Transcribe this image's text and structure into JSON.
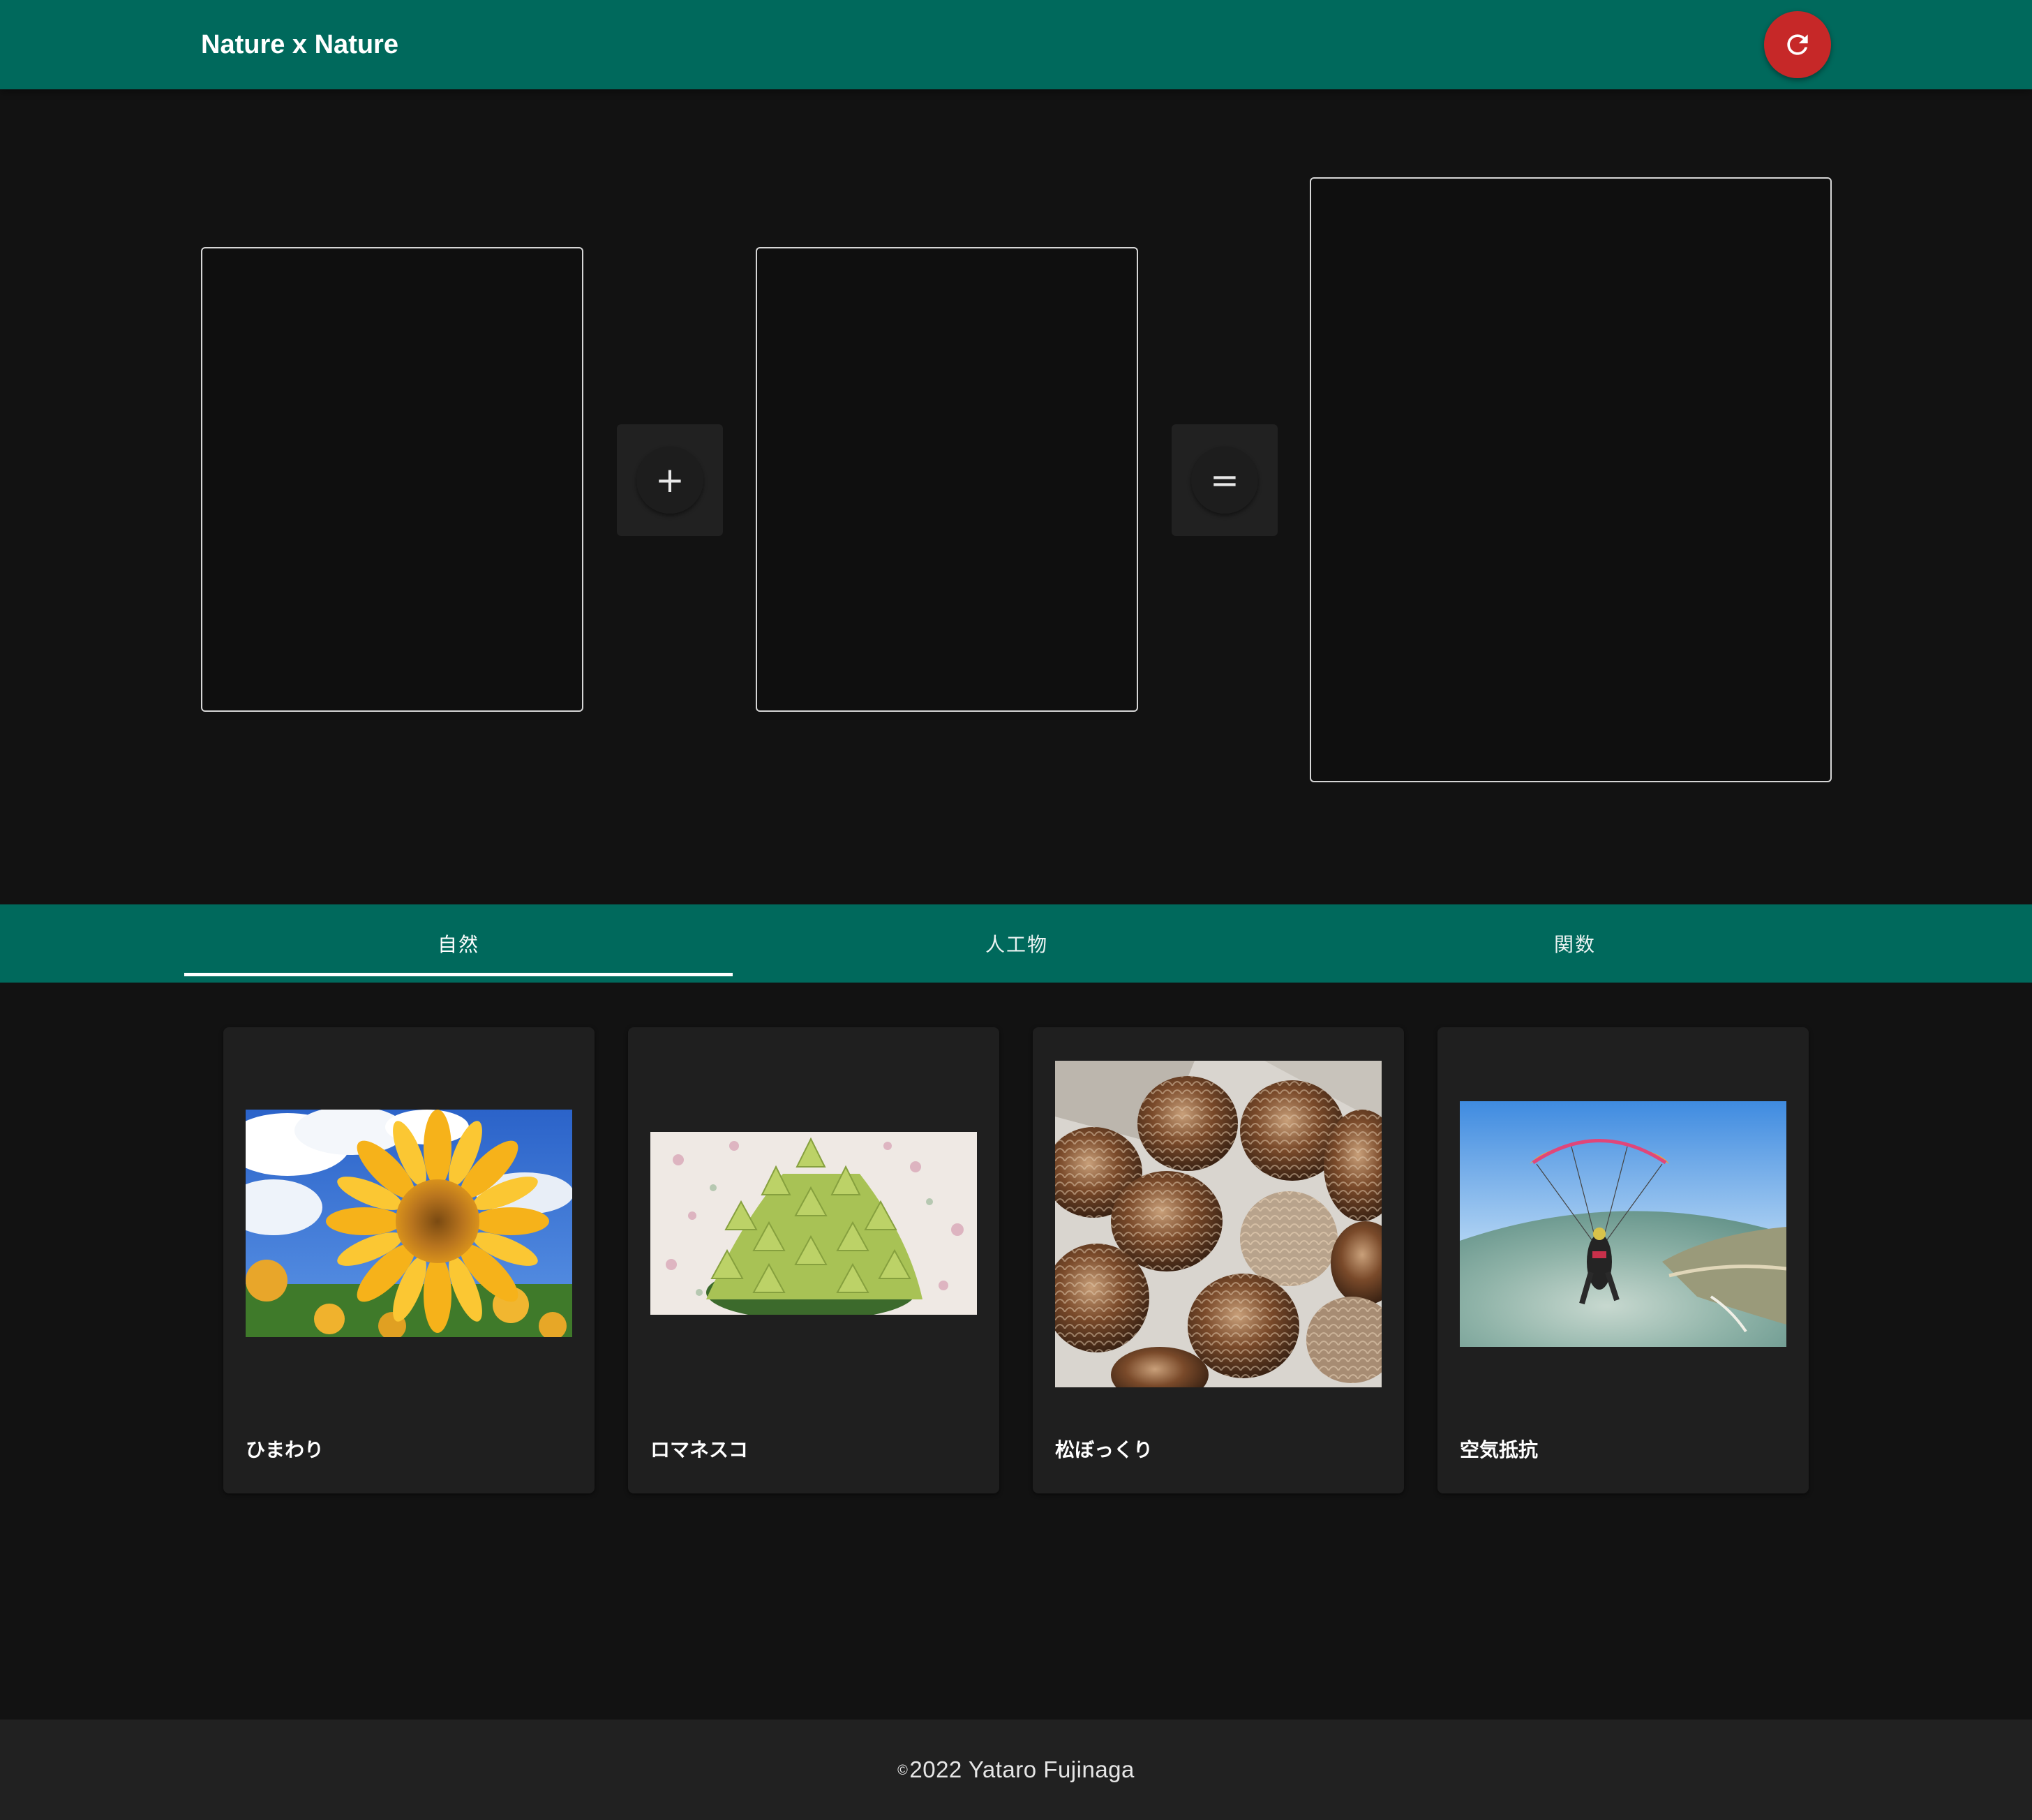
{
  "app": {
    "title": "Nature x Nature",
    "reset_icon": "refresh-icon"
  },
  "colors": {
    "primary": "#00695c",
    "accent_red": "#c62828",
    "background": "#121212",
    "surface": "#1f1f1f",
    "footer": "#212121"
  },
  "equation": {
    "operator_plus": "+",
    "operator_equals": "="
  },
  "tabs": {
    "items": [
      {
        "label": "自然"
      },
      {
        "label": "人工物"
      },
      {
        "label": "関数"
      }
    ],
    "selected": 0
  },
  "cards": [
    {
      "label": "ひまわり",
      "image": "sunflower photo"
    },
    {
      "label": "ロマネスコ",
      "image": "romanesco photo"
    },
    {
      "label": "松ぼっくり",
      "image": "pine cones photo"
    },
    {
      "label": "空気抵抗",
      "image": "paraglider photo"
    }
  ],
  "footer": {
    "copyright_symbol": "©",
    "text": "2022 Yataro Fujinaga"
  }
}
